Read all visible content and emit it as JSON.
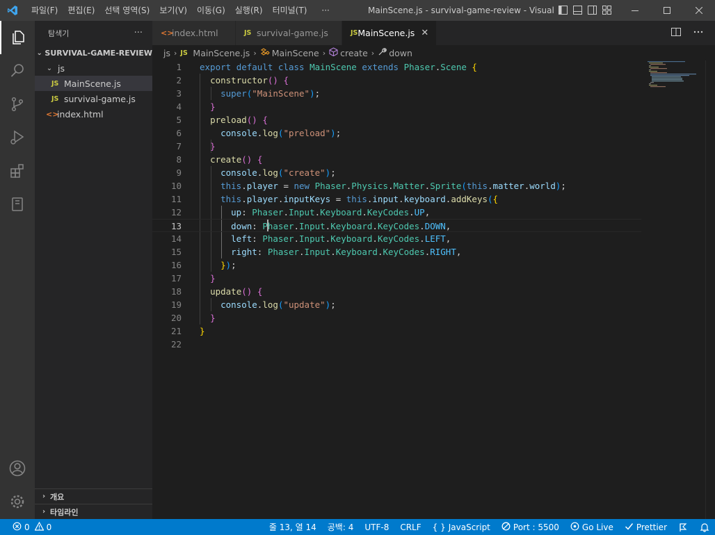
{
  "window": {
    "title": "MainScene.js - survival-game-review - Visual Stu...",
    "menu": [
      "파일(F)",
      "편집(E)",
      "선택 영역(S)",
      "보기(V)",
      "이동(G)",
      "실행(R)",
      "터미널(T)",
      "···"
    ]
  },
  "colors": {
    "accent": "#007acc",
    "activitybar": "#333333",
    "sidebar": "#252526",
    "editor": "#1e1e1e"
  },
  "activitybar": {
    "items": [
      "explorer-icon",
      "search-icon",
      "source-control-icon",
      "run-debug-icon",
      "extensions-icon",
      "remote-explorer-icon"
    ],
    "bottom": [
      "account-icon",
      "manage-gear-icon"
    ]
  },
  "sidebar": {
    "title": "탐색기",
    "more": "···",
    "root": "SURVIVAL-GAME-REVIEW",
    "folder": "js",
    "files": [
      {
        "badge": "JS",
        "name": "MainScene.js"
      },
      {
        "badge": "JS",
        "name": "survival-game.js"
      }
    ],
    "root_file": {
      "badge": "<>",
      "name": "index.html"
    },
    "outline": "개요",
    "timeline": "타임라인"
  },
  "tabs": [
    {
      "badge": "<>",
      "label": "index.html"
    },
    {
      "badge": "JS",
      "label": "survival-game.js"
    },
    {
      "badge": "JS",
      "label": "MainScene.js",
      "close": "✕"
    }
  ],
  "breadcrumb": {
    "folder": "js",
    "file_badge": "JS",
    "file": "MainScene.js",
    "class": "MainScene",
    "method": "create",
    "symbol": "down"
  },
  "editor": {
    "line_numbers": [
      "1",
      "2",
      "3",
      "4",
      "5",
      "6",
      "7",
      "8",
      "9",
      "10",
      "11",
      "12",
      "13",
      "14",
      "15",
      "16",
      "17",
      "18",
      "19",
      "20",
      "21",
      "22"
    ],
    "current_line": 13,
    "lines": [
      "export default class MainScene extends Phaser.Scene {",
      "  constructor() {",
      "    super(\"MainScene\");",
      "  }",
      "  preload() {",
      "    console.log(\"preload\");",
      "  }",
      "  create() {",
      "    console.log(\"create\");",
      "    this.player = new Phaser.Physics.Matter.Sprite(this.matter.world);",
      "    this.player.inputKeys = this.input.keyboard.addKeys({",
      "      up: Phaser.Input.Keyboard.KeyCodes.UP,",
      "      down: Phaser.Input.Keyboard.KeyCodes.DOWN,",
      "      left: Phaser.Input.Keyboard.KeyCodes.LEFT,",
      "      right: Phaser.Input.Keyboard.KeyCodes.RIGHT,",
      "    });",
      "  }",
      "  update() {",
      "    console.log(\"update\");",
      "  }",
      "}",
      ""
    ]
  },
  "statusbar": {
    "errors": "0",
    "warnings": "0",
    "position": "줄 13, 열 14",
    "indent": "공백: 4",
    "encoding": "UTF-8",
    "eol": "CRLF",
    "language_icon": "{ }",
    "language": "JavaScript",
    "port": "Port : 5500",
    "golive": "Go Live",
    "prettier": "Prettier"
  }
}
